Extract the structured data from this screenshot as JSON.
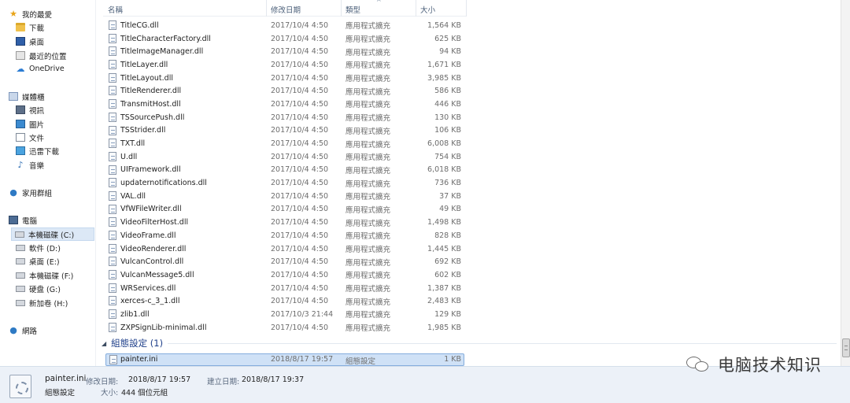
{
  "nav": {
    "favorites": "我的最愛",
    "downloads": "下載",
    "desktop": "桌面",
    "recent": "最近的位置",
    "onedrive": "OneDrive",
    "libraries": "媒體櫃",
    "videos": "視訊",
    "pictures": "圖片",
    "documents": "文件",
    "thunder": "迅雷下載",
    "music": "音樂",
    "homegroup": "家用群組",
    "computer": "電腦",
    "drive_c": "本機磁碟 (C:)",
    "drive_d": "軟件 (D:)",
    "drive_e": "桌面 (E:)",
    "drive_f": "本機磁碟 (F:)",
    "drive_g": "硬盘 (G:)",
    "drive_h": "新加卷 (H:)",
    "network": "網路"
  },
  "columns": {
    "name": "名稱",
    "date": "修改日期",
    "type": "類型",
    "size": "大小"
  },
  "files": [
    {
      "name": "TitleCG.dll",
      "date": "2017/10/4 4:50",
      "type": "應用程式擴充",
      "size": "1,564 KB"
    },
    {
      "name": "TitleCharacterFactory.dll",
      "date": "2017/10/4 4:50",
      "type": "應用程式擴充",
      "size": "625 KB"
    },
    {
      "name": "TitleImageManager.dll",
      "date": "2017/10/4 4:50",
      "type": "應用程式擴充",
      "size": "94 KB"
    },
    {
      "name": "TitleLayer.dll",
      "date": "2017/10/4 4:50",
      "type": "應用程式擴充",
      "size": "1,671 KB"
    },
    {
      "name": "TitleLayout.dll",
      "date": "2017/10/4 4:50",
      "type": "應用程式擴充",
      "size": "3,985 KB"
    },
    {
      "name": "TitleRenderer.dll",
      "date": "2017/10/4 4:50",
      "type": "應用程式擴充",
      "size": "586 KB"
    },
    {
      "name": "TransmitHost.dll",
      "date": "2017/10/4 4:50",
      "type": "應用程式擴充",
      "size": "446 KB"
    },
    {
      "name": "TSSourcePush.dll",
      "date": "2017/10/4 4:50",
      "type": "應用程式擴充",
      "size": "130 KB"
    },
    {
      "name": "TSStrider.dll",
      "date": "2017/10/4 4:50",
      "type": "應用程式擴充",
      "size": "106 KB"
    },
    {
      "name": "TXT.dll",
      "date": "2017/10/4 4:50",
      "type": "應用程式擴充",
      "size": "6,008 KB"
    },
    {
      "name": "U.dll",
      "date": "2017/10/4 4:50",
      "type": "應用程式擴充",
      "size": "754 KB"
    },
    {
      "name": "UIFramework.dll",
      "date": "2017/10/4 4:50",
      "type": "應用程式擴充",
      "size": "6,018 KB"
    },
    {
      "name": "updaternotifications.dll",
      "date": "2017/10/4 4:50",
      "type": "應用程式擴充",
      "size": "736 KB"
    },
    {
      "name": "VAL.dll",
      "date": "2017/10/4 4:50",
      "type": "應用程式擴充",
      "size": "37 KB"
    },
    {
      "name": "VfWFileWriter.dll",
      "date": "2017/10/4 4:50",
      "type": "應用程式擴充",
      "size": "49 KB"
    },
    {
      "name": "VideoFilterHost.dll",
      "date": "2017/10/4 4:50",
      "type": "應用程式擴充",
      "size": "1,498 KB"
    },
    {
      "name": "VideoFrame.dll",
      "date": "2017/10/4 4:50",
      "type": "應用程式擴充",
      "size": "828 KB"
    },
    {
      "name": "VideoRenderer.dll",
      "date": "2017/10/4 4:50",
      "type": "應用程式擴充",
      "size": "1,445 KB"
    },
    {
      "name": "VulcanControl.dll",
      "date": "2017/10/4 4:50",
      "type": "應用程式擴充",
      "size": "692 KB"
    },
    {
      "name": "VulcanMessage5.dll",
      "date": "2017/10/4 4:50",
      "type": "應用程式擴充",
      "size": "602 KB"
    },
    {
      "name": "WRServices.dll",
      "date": "2017/10/4 4:50",
      "type": "應用程式擴充",
      "size": "1,387 KB"
    },
    {
      "name": "xerces-c_3_1.dll",
      "date": "2017/10/4 4:50",
      "type": "應用程式擴充",
      "size": "2,483 KB"
    },
    {
      "name": "zlib1.dll",
      "date": "2017/10/3 21:44",
      "type": "應用程式擴充",
      "size": "129 KB"
    },
    {
      "name": "ZXPSignLib-minimal.dll",
      "date": "2017/10/4 4:50",
      "type": "應用程式擴充",
      "size": "1,985 KB"
    }
  ],
  "group": {
    "label": "組態設定 (1)"
  },
  "selected_file": {
    "name": "painter.ini",
    "date": "2018/8/17 19:57",
    "type": "組態設定",
    "size": "1 KB"
  },
  "details": {
    "name": "painter.ini",
    "modified_label": "修改日期:",
    "modified_value": "2018/8/17 19:57",
    "created_label": "建立日期:",
    "created_value": "2018/8/17 19:37",
    "type": "組態設定",
    "size_label": "大小:",
    "size_value": "444 個位元組"
  },
  "watermark": {
    "text": "电脑技术知识"
  },
  "icons": {
    "favorites": "star-icon",
    "folder": "folder-icon",
    "file": "dll-file-icon",
    "ini": "ini-file-icon",
    "watermark": "wechat-icon"
  }
}
